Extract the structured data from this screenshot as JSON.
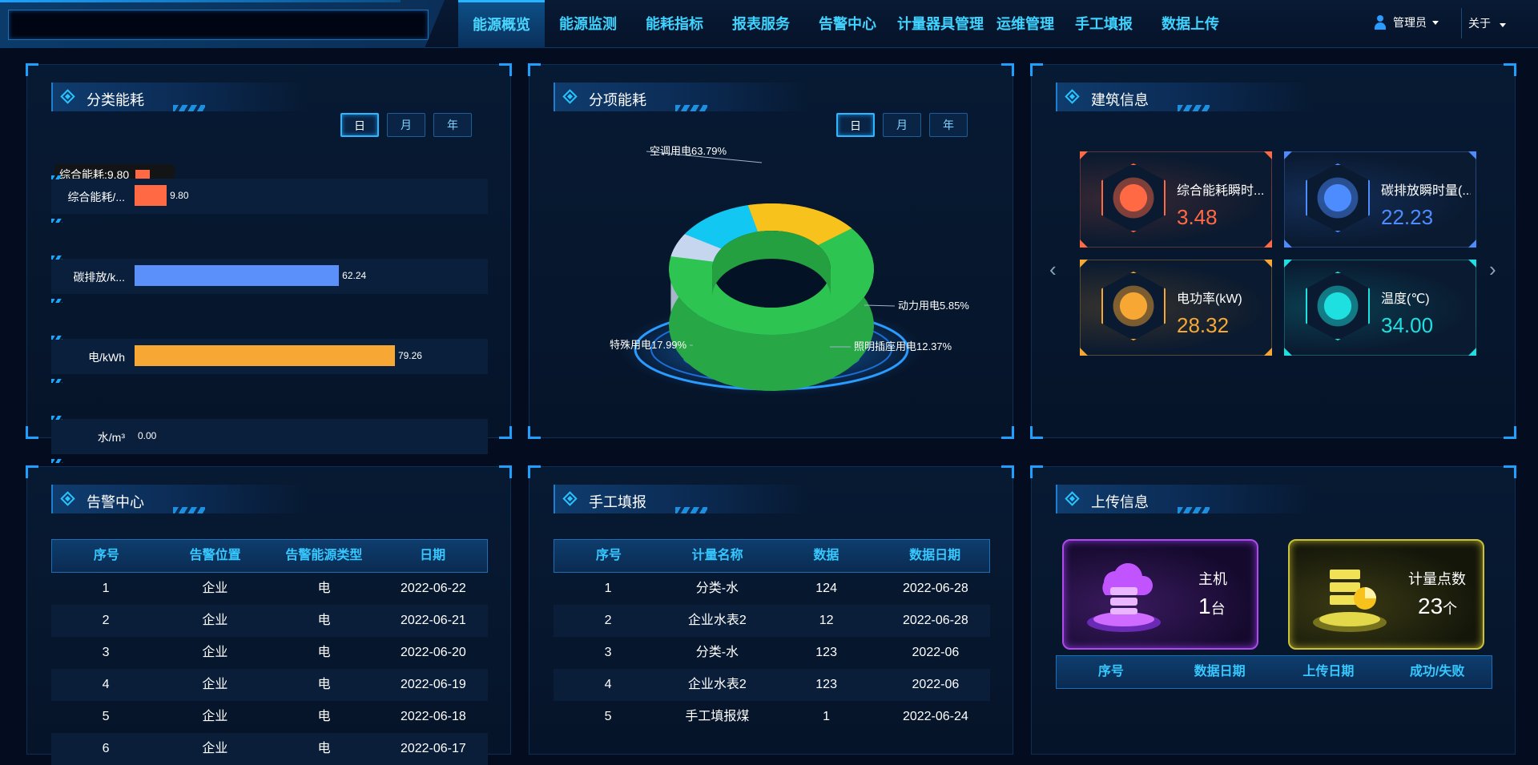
{
  "nav": {
    "items": [
      "能源概览",
      "能源监测",
      "能耗指标",
      "报表服务",
      "告警中心",
      "计量器具管理",
      "运维管理",
      "手工填报",
      "数据上传"
    ],
    "active": "能源概览",
    "user": "管理员",
    "about": "关于"
  },
  "category": {
    "title": "分类能耗",
    "tabs": [
      "日",
      "月",
      "年"
    ],
    "active_tab": "日",
    "tooltip": "综合能耗:9.80",
    "bars": [
      {
        "label": "综合能耗/...",
        "value": 9.8,
        "display": "9.80",
        "color": "#ff6a45"
      },
      {
        "label": "碳排放/k...",
        "value": 62.24,
        "display": "62.24",
        "color": "#5b8ff9"
      },
      {
        "label": "电/kWh",
        "value": 79.26,
        "display": "79.26",
        "color": "#f7a733"
      },
      {
        "label": "水/m³",
        "value": 0.0,
        "display": "0.00",
        "color": "#2fb6ff"
      }
    ]
  },
  "itemized": {
    "title": "分项能耗",
    "tabs": [
      "日",
      "月",
      "年"
    ],
    "active_tab": "日",
    "chart_data": {
      "type": "pie",
      "categories": [
        "空调用电",
        "动力用电",
        "照明插座用电",
        "特殊用电"
      ],
      "values": [
        63.79,
        5.85,
        12.37,
        17.99
      ],
      "labels": [
        "空调用电63.79%",
        "动力用电5.85%",
        "照明插座用电12.37%",
        "特殊用电17.99%"
      ],
      "colors": [
        "#2ec451",
        "#c6d6ee",
        "#12c8f2",
        "#f6c21b"
      ]
    }
  },
  "building": {
    "title": "建筑信息",
    "cards": [
      {
        "label": "综合能耗瞬时...",
        "value": "3.48",
        "color": "#ff6a45",
        "icon": "pie-chart-icon"
      },
      {
        "label": "碳排放瞬时量(...",
        "value": "22.23",
        "color": "#4d8cff",
        "icon": "co2-cloud-icon"
      },
      {
        "label": "电功率(kW)",
        "value": "28.32",
        "color": "#f7a733",
        "icon": "power-icon"
      },
      {
        "label": "温度(℃)",
        "value": "34.00",
        "color": "#1ee0e0",
        "icon": "thermometer-icon"
      }
    ],
    "prev": "‹",
    "next": "›"
  },
  "alarm": {
    "title": "告警中心",
    "columns": [
      "序号",
      "告警位置",
      "告警能源类型",
      "日期"
    ],
    "rows": [
      [
        "1",
        "企业",
        "电",
        "2022-06-22"
      ],
      [
        "2",
        "企业",
        "电",
        "2022-06-21"
      ],
      [
        "3",
        "企业",
        "电",
        "2022-06-20"
      ],
      [
        "4",
        "企业",
        "电",
        "2022-06-19"
      ],
      [
        "5",
        "企业",
        "电",
        "2022-06-18"
      ],
      [
        "6",
        "企业",
        "电",
        "2022-06-17"
      ]
    ]
  },
  "manual": {
    "title": "手工填报",
    "columns": [
      "序号",
      "计量名称",
      "数据",
      "数据日期"
    ],
    "rows": [
      [
        "1",
        "分类-水",
        "124",
        "2022-06-28"
      ],
      [
        "2",
        "企业水表2",
        "12",
        "2022-06-28"
      ],
      [
        "3",
        "分类-水",
        "123",
        "2022-06"
      ],
      [
        "4",
        "企业水表2",
        "123",
        "2022-06"
      ],
      [
        "5",
        "手工填报煤",
        "1",
        "2022-06-24"
      ]
    ]
  },
  "upload": {
    "title": "上传信息",
    "host_label": "主机",
    "host_value": "1",
    "host_unit": "台",
    "meter_label": "计量点数",
    "meter_value": "23",
    "meter_unit": "个",
    "columns": [
      "序号",
      "数据日期",
      "上传日期",
      "成功/失败"
    ]
  }
}
